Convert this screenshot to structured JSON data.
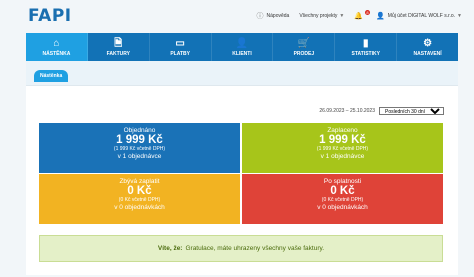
{
  "app": {
    "logo": "FAPI"
  },
  "topbar": {
    "help_label": "Nápověda",
    "projects_label": "Všechny projekty",
    "notifications_count": "8",
    "account_label": "Můj účet DIGITAL WOLF s.r.o."
  },
  "nav": {
    "tabs": [
      {
        "label": "NÁSTĚNKA",
        "icon": "home-icon",
        "active": true
      },
      {
        "label": "FAKTURY",
        "icon": "document-icon"
      },
      {
        "label": "PLATBY",
        "icon": "credit-card-icon"
      },
      {
        "label": "KLIENTI",
        "icon": "user-icon"
      },
      {
        "label": "PRODEJ",
        "icon": "cart-icon"
      },
      {
        "label": "STATISTIKY",
        "icon": "bar-chart-icon"
      },
      {
        "label": "NASTAVENÍ",
        "icon": "gear-icon"
      }
    ]
  },
  "subtab": {
    "label": "Nástěnka"
  },
  "date_filter": {
    "range": "26.09.2023 – 25.10.2023",
    "selected_option": "Posledních 30 dní"
  },
  "tiles": {
    "ordered": {
      "title": "Objednáno",
      "amount": "1 999 Kč",
      "vat": "(1 999 Kč včetně DPH)",
      "count": "v 1 objednávce",
      "color": "#1a72b7"
    },
    "paid": {
      "title": "Zaplaceno",
      "amount": "1 999 Kč",
      "vat": "(1 999 Kč včetně DPH)",
      "count": "v 1 objednávce",
      "color": "#a7c51a"
    },
    "remaining": {
      "title": "Zbývá zaplatit",
      "amount": "0 Kč",
      "vat": "(0 Kč včetně DPH)",
      "count": "v 0 objednávkách",
      "color": "#f2b322"
    },
    "overdue": {
      "title": "Po splatnosti",
      "amount": "0 Kč",
      "vat": "(0 Kč včetně DPH)",
      "count": "v 0 objednávkách",
      "color": "#df4338"
    }
  },
  "alert": {
    "prefix": "Víte, že:",
    "text": "Gratulace, máte uhrazeny všechny vaše faktury."
  }
}
